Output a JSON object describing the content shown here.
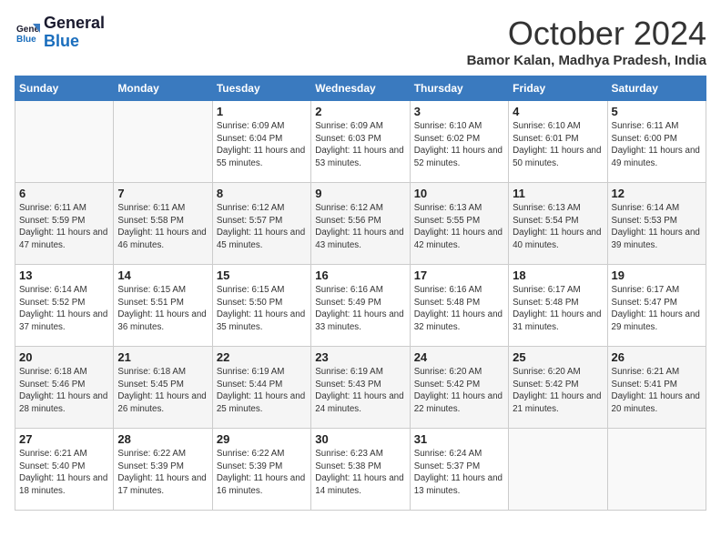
{
  "header": {
    "logo_text_general": "General",
    "logo_text_blue": "Blue",
    "month_title": "October 2024",
    "location": "Bamor Kalan, Madhya Pradesh, India"
  },
  "columns": [
    "Sunday",
    "Monday",
    "Tuesday",
    "Wednesday",
    "Thursday",
    "Friday",
    "Saturday"
  ],
  "weeks": [
    {
      "days": [
        {
          "number": "",
          "empty": true
        },
        {
          "number": "",
          "empty": true
        },
        {
          "number": "1",
          "sunrise": "6:09 AM",
          "sunset": "6:04 PM",
          "daylight": "11 hours and 55 minutes."
        },
        {
          "number": "2",
          "sunrise": "6:09 AM",
          "sunset": "6:03 PM",
          "daylight": "11 hours and 53 minutes."
        },
        {
          "number": "3",
          "sunrise": "6:10 AM",
          "sunset": "6:02 PM",
          "daylight": "11 hours and 52 minutes."
        },
        {
          "number": "4",
          "sunrise": "6:10 AM",
          "sunset": "6:01 PM",
          "daylight": "11 hours and 50 minutes."
        },
        {
          "number": "5",
          "sunrise": "6:11 AM",
          "sunset": "6:00 PM",
          "daylight": "11 hours and 49 minutes."
        }
      ]
    },
    {
      "days": [
        {
          "number": "6",
          "sunrise": "6:11 AM",
          "sunset": "5:59 PM",
          "daylight": "11 hours and 47 minutes."
        },
        {
          "number": "7",
          "sunrise": "6:11 AM",
          "sunset": "5:58 PM",
          "daylight": "11 hours and 46 minutes."
        },
        {
          "number": "8",
          "sunrise": "6:12 AM",
          "sunset": "5:57 PM",
          "daylight": "11 hours and 45 minutes."
        },
        {
          "number": "9",
          "sunrise": "6:12 AM",
          "sunset": "5:56 PM",
          "daylight": "11 hours and 43 minutes."
        },
        {
          "number": "10",
          "sunrise": "6:13 AM",
          "sunset": "5:55 PM",
          "daylight": "11 hours and 42 minutes."
        },
        {
          "number": "11",
          "sunrise": "6:13 AM",
          "sunset": "5:54 PM",
          "daylight": "11 hours and 40 minutes."
        },
        {
          "number": "12",
          "sunrise": "6:14 AM",
          "sunset": "5:53 PM",
          "daylight": "11 hours and 39 minutes."
        }
      ]
    },
    {
      "days": [
        {
          "number": "13",
          "sunrise": "6:14 AM",
          "sunset": "5:52 PM",
          "daylight": "11 hours and 37 minutes."
        },
        {
          "number": "14",
          "sunrise": "6:15 AM",
          "sunset": "5:51 PM",
          "daylight": "11 hours and 36 minutes."
        },
        {
          "number": "15",
          "sunrise": "6:15 AM",
          "sunset": "5:50 PM",
          "daylight": "11 hours and 35 minutes."
        },
        {
          "number": "16",
          "sunrise": "6:16 AM",
          "sunset": "5:49 PM",
          "daylight": "11 hours and 33 minutes."
        },
        {
          "number": "17",
          "sunrise": "6:16 AM",
          "sunset": "5:48 PM",
          "daylight": "11 hours and 32 minutes."
        },
        {
          "number": "18",
          "sunrise": "6:17 AM",
          "sunset": "5:48 PM",
          "daylight": "11 hours and 31 minutes."
        },
        {
          "number": "19",
          "sunrise": "6:17 AM",
          "sunset": "5:47 PM",
          "daylight": "11 hours and 29 minutes."
        }
      ]
    },
    {
      "days": [
        {
          "number": "20",
          "sunrise": "6:18 AM",
          "sunset": "5:46 PM",
          "daylight": "11 hours and 28 minutes."
        },
        {
          "number": "21",
          "sunrise": "6:18 AM",
          "sunset": "5:45 PM",
          "daylight": "11 hours and 26 minutes."
        },
        {
          "number": "22",
          "sunrise": "6:19 AM",
          "sunset": "5:44 PM",
          "daylight": "11 hours and 25 minutes."
        },
        {
          "number": "23",
          "sunrise": "6:19 AM",
          "sunset": "5:43 PM",
          "daylight": "11 hours and 24 minutes."
        },
        {
          "number": "24",
          "sunrise": "6:20 AM",
          "sunset": "5:42 PM",
          "daylight": "11 hours and 22 minutes."
        },
        {
          "number": "25",
          "sunrise": "6:20 AM",
          "sunset": "5:42 PM",
          "daylight": "11 hours and 21 minutes."
        },
        {
          "number": "26",
          "sunrise": "6:21 AM",
          "sunset": "5:41 PM",
          "daylight": "11 hours and 20 minutes."
        }
      ]
    },
    {
      "days": [
        {
          "number": "27",
          "sunrise": "6:21 AM",
          "sunset": "5:40 PM",
          "daylight": "11 hours and 18 minutes."
        },
        {
          "number": "28",
          "sunrise": "6:22 AM",
          "sunset": "5:39 PM",
          "daylight": "11 hours and 17 minutes."
        },
        {
          "number": "29",
          "sunrise": "6:22 AM",
          "sunset": "5:39 PM",
          "daylight": "11 hours and 16 minutes."
        },
        {
          "number": "30",
          "sunrise": "6:23 AM",
          "sunset": "5:38 PM",
          "daylight": "11 hours and 14 minutes."
        },
        {
          "number": "31",
          "sunrise": "6:24 AM",
          "sunset": "5:37 PM",
          "daylight": "11 hours and 13 minutes."
        },
        {
          "number": "",
          "empty": true
        },
        {
          "number": "",
          "empty": true
        }
      ]
    }
  ]
}
